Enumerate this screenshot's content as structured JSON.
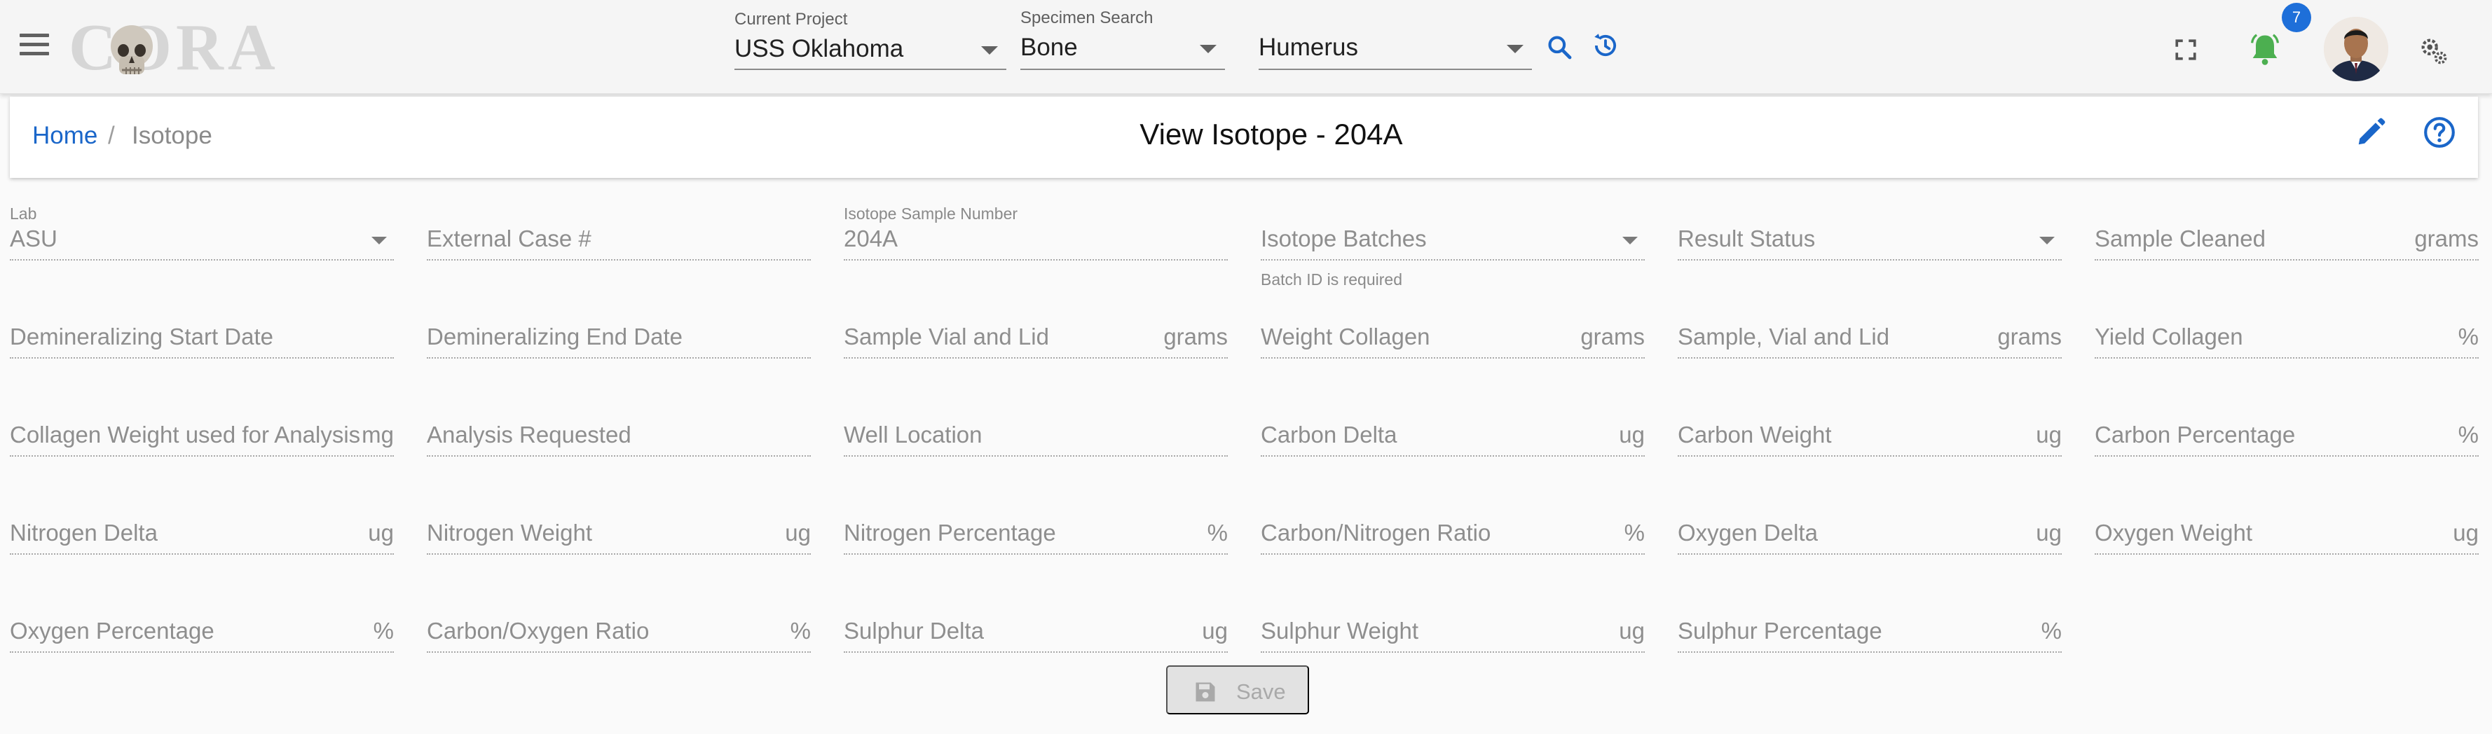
{
  "app": {
    "logo_text": "CORA"
  },
  "topbar": {
    "current_project": {
      "label": "Current Project",
      "value": "USS Oklahoma"
    },
    "specimen_search": {
      "label": "Specimen Search",
      "type_value": "Bone",
      "element_value": "Humerus"
    },
    "notifications_count": "7",
    "icons": [
      "menu-icon",
      "search-icon",
      "history-icon",
      "fullscreen-icon",
      "bell-icon",
      "settings-icon"
    ]
  },
  "header": {
    "breadcrumb": {
      "home": "Home",
      "separator": "/",
      "current": "Isotope"
    },
    "title": "View Isotope - 204A"
  },
  "form": {
    "rows": [
      [
        {
          "label": "Lab",
          "value": "ASU",
          "unit": "",
          "dropdown": true
        },
        {
          "label": "External Case #",
          "value": "",
          "unit": ""
        },
        {
          "label": "Isotope Sample Number",
          "value": "204A",
          "unit": ""
        },
        {
          "label": "Isotope Batches",
          "value": "",
          "unit": "",
          "dropdown": true,
          "helper": "Batch ID is required"
        },
        {
          "label": "Result Status",
          "value": "",
          "unit": "",
          "dropdown": true
        },
        {
          "label": "Sample Cleaned",
          "value": "",
          "unit": "grams"
        }
      ],
      [
        {
          "label": "Demineralizing Start Date",
          "value": "",
          "unit": ""
        },
        {
          "label": "Demineralizing End Date",
          "value": "",
          "unit": ""
        },
        {
          "label": "Sample Vial and Lid",
          "value": "",
          "unit": "grams"
        },
        {
          "label": "Weight Collagen",
          "value": "",
          "unit": "grams"
        },
        {
          "label": "Sample, Vial and Lid",
          "value": "",
          "unit": "grams"
        },
        {
          "label": "Yield Collagen",
          "value": "",
          "unit": "%"
        }
      ],
      [
        {
          "label": "Collagen Weight used for Analysis",
          "value": "",
          "unit": "mg"
        },
        {
          "label": "Analysis Requested",
          "value": "",
          "unit": ""
        },
        {
          "label": "Well Location",
          "value": "",
          "unit": ""
        },
        {
          "label": "Carbon Delta",
          "value": "",
          "unit": "ug"
        },
        {
          "label": "Carbon Weight",
          "value": "",
          "unit": "ug"
        },
        {
          "label": "Carbon Percentage",
          "value": "",
          "unit": "%"
        }
      ],
      [
        {
          "label": "Nitrogen Delta",
          "value": "",
          "unit": "ug"
        },
        {
          "label": "Nitrogen Weight",
          "value": "",
          "unit": "ug"
        },
        {
          "label": "Nitrogen Percentage",
          "value": "",
          "unit": "%"
        },
        {
          "label": "Carbon/Nitrogen Ratio",
          "value": "",
          "unit": "%"
        },
        {
          "label": "Oxygen Delta",
          "value": "",
          "unit": "ug"
        },
        {
          "label": "Oxygen Weight",
          "value": "",
          "unit": "ug"
        }
      ],
      [
        {
          "label": "Oxygen Percentage",
          "value": "",
          "unit": "%"
        },
        {
          "label": "Carbon/Oxygen Ratio",
          "value": "",
          "unit": "%"
        },
        {
          "label": "Sulphur Delta",
          "value": "",
          "unit": "ug"
        },
        {
          "label": "Sulphur Weight",
          "value": "",
          "unit": "ug"
        },
        {
          "label": "Sulphur Percentage",
          "value": "",
          "unit": "%"
        }
      ]
    ],
    "save_label": "Save"
  },
  "colors": {
    "accent": "#1a66c9",
    "bell": "#4caf50",
    "badge": "#1e6fd9"
  }
}
